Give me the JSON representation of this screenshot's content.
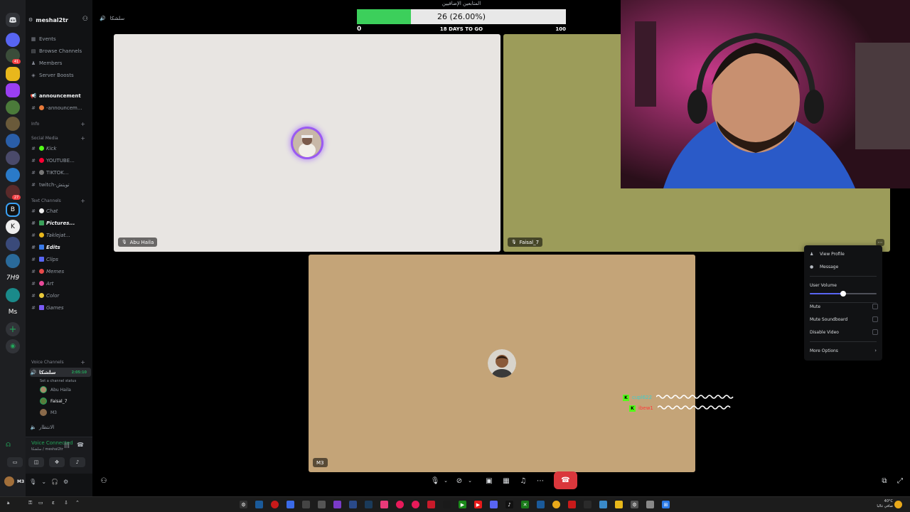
{
  "app": {
    "name": "Discord"
  },
  "server": {
    "name": "meshal2tr"
  },
  "nav_items": [
    {
      "label": "Events",
      "icon": "calendar-icon"
    },
    {
      "label": "Browse Channels",
      "icon": "browse-icon"
    },
    {
      "label": "Members",
      "icon": "members-icon"
    },
    {
      "label": "Server Boosts",
      "icon": "boost-icon"
    }
  ],
  "channels": {
    "announcement": "announcement",
    "announcement_sub": "-announcem...",
    "cat_info": "Info",
    "cat_social": "Social Media",
    "kick": "Kick",
    "youtube": "YOUTUBE...",
    "tiktok": "TIKTOK...",
    "twitch": "twitch-تويتش",
    "cat_text": "Text Channels",
    "chat": "Chat",
    "pictures": "Pictures...",
    "taklejat": "Taklejat...",
    "edits": "Edits",
    "clips": "Clips",
    "memes": "Memes",
    "art": "Art",
    "color": "Color",
    "games": "Games",
    "cat_voice": "Voice Channels",
    "voice_channel": "سلشكا",
    "voice_time": "2:05:10",
    "voice_status": "Set a channel status",
    "voice_users": [
      "Abu Haila",
      "Faisal_7",
      "M3"
    ],
    "bottom_channel": "الانتظار"
  },
  "voice_panel": {
    "status": "Voice Connected",
    "sub": "سلشكا / meshal2tr"
  },
  "user": {
    "name": "M3"
  },
  "header": {
    "channel_title": "سلشكا"
  },
  "progress": {
    "title": "المتابعين الإضافيين",
    "text": "26 (26.00%)",
    "value": 26,
    "min": "0",
    "max": "100",
    "mid": "18 DAYS TO GO",
    "fill_color": "#3ccf5b"
  },
  "tiles": [
    {
      "name": "Abu Haila",
      "bg": "#e8e5e2"
    },
    {
      "name": "Faisal_7",
      "bg": "#9c9c5a"
    },
    {
      "name": "M3",
      "bg": "#c4a478"
    }
  ],
  "context_menu": {
    "view_profile": "View Profile",
    "message": "Message",
    "user_volume": "User Volume",
    "volume_level": 0.5,
    "mute": "Mute",
    "mute_soundboard": "Mute Soundboard",
    "disable_video": "Disable Video",
    "more_options": "More Options"
  },
  "chat": [
    {
      "user": "cupl622",
      "color": "#3ccfce"
    },
    {
      "user": "ibew1",
      "color": "#ff3a3a"
    }
  ],
  "taskbar": {
    "weather": "40°C",
    "clock": "صافي غالبا"
  },
  "colors": {
    "accent": "#5865f2",
    "hangup": "#da373c",
    "kick": "#53fc18"
  }
}
